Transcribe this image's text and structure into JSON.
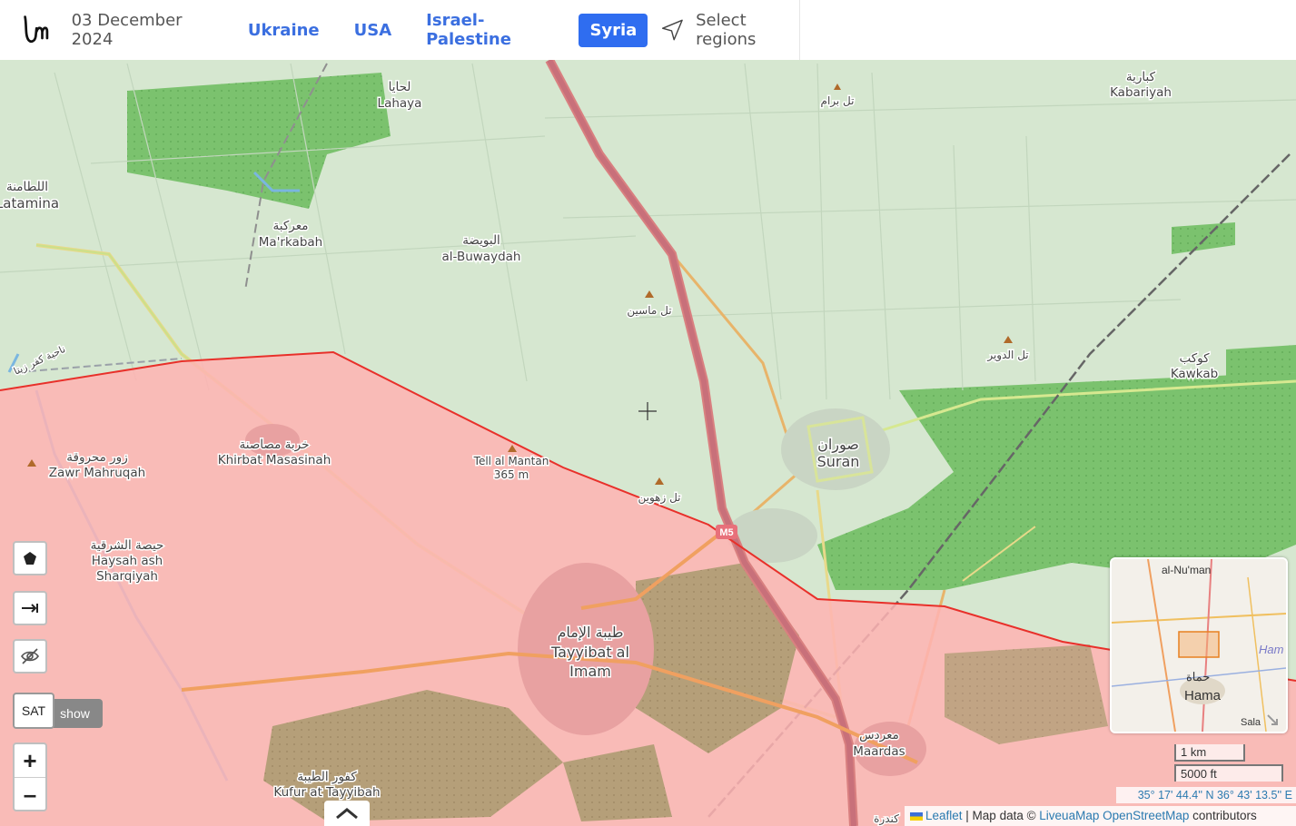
{
  "header": {
    "date": "03 December 2024",
    "tabs": [
      {
        "label": "Ukraine",
        "active": false
      },
      {
        "label": "USA",
        "active": false
      },
      {
        "label": "Israel-Palestine",
        "active": false
      },
      {
        "label": "Syria",
        "active": true
      }
    ],
    "select_regions": "Select regions"
  },
  "map": {
    "places": {
      "latamina_ar": "اللطامنة",
      "latamina": "Latamina",
      "lahaya_ar": "لحايا",
      "lahaya": "Lahaya",
      "markabah_ar": "معركبة",
      "markabah": "Ma'rkabah",
      "buwaydah_ar": "البويضة",
      "buwaydah": "al-Buwaydah",
      "tell_masin_ar": "تل ماسين",
      "tell_baram_ar": "تل برام",
      "kabariyah_ar": "كبارية",
      "kabariyah": "Kabariyah",
      "tell_dweir_ar": "تل الدوير",
      "kawkab_ar": "كوكب",
      "kawkab": "Kawkab",
      "suran_ar": "صوران",
      "suran": "Suran",
      "nahiya_ar": "ناحية كفر زيتا",
      "zawr_ar": "زور محروقة",
      "zawr": "Zawr Mahruqah",
      "khirbat_ar": "خربة مصاصنة",
      "khirbat": "Khirbat Masasinah",
      "tell_mantan": "Tell al Mantan",
      "tell_mantan_elev": "365 m",
      "tell_zahwin_ar": "تل زهوين",
      "haysah_ar": "حيصة الشرقية",
      "haysah_1": "Haysah ash",
      "haysah_2": "Sharqiyah",
      "tayyibat_ar": "طيبة الإمام",
      "tayyibat_1": "Tayyibat al",
      "tayyibat_2": "Imam",
      "kufur_ar": "كفور الطيبة",
      "kufur": "Kufur at Tayyibah",
      "maardas_ar": "معردس",
      "maardas": "Maardas",
      "kundura_ar": "كندرة",
      "road_m5": "M5"
    },
    "controls": {
      "polygon_icon": "pentagon-icon",
      "measure_icon": "arrow-right-to-bar-icon",
      "hide_icon": "eye-slash-icon",
      "show_label": "show",
      "sat_label": "SAT",
      "zoom_in": "+",
      "zoom_out": "–"
    },
    "minimap": {
      "label_top": "al-Nu'man",
      "hama_ar": "حماة",
      "hama": "Hama",
      "ham": "Ham",
      "sala": "Sala"
    },
    "scale": {
      "km": "1 km",
      "ft": "5000 ft"
    },
    "coords": "35° 17' 44.4'' N 36° 43' 13.5'' E",
    "attribution": {
      "leaflet": "Leaflet",
      "sep": " | Map data © ",
      "liveuamap": "LiveuaMap",
      "osm": "OpenStreetMap",
      "suffix": " contributors"
    },
    "colors": {
      "occupied_fill": "#ffb3b3",
      "frontline": "#e8302a",
      "terrain": "#d6e7d0",
      "forest": "#7bc26e",
      "accent": "#2f6df0"
    }
  }
}
